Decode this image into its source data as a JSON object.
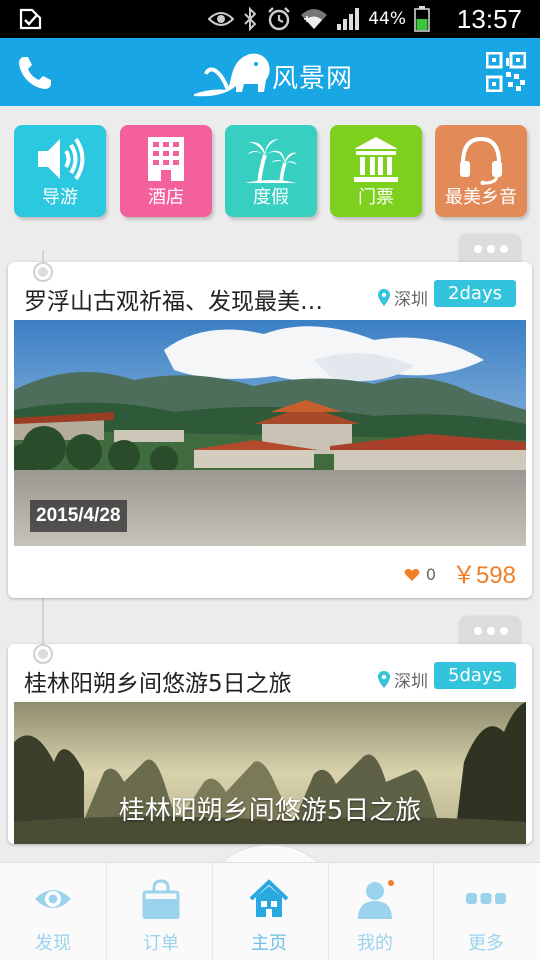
{
  "status_bar": {
    "battery_percent": "44%",
    "time": "13:57",
    "icons": [
      "sim-icon",
      "eye-icon",
      "bluetooth-icon",
      "alarm-icon",
      "wifi-icon",
      "signal-icon",
      "battery-icon"
    ]
  },
  "header": {
    "title": "风景网",
    "left_icon": "phone-icon",
    "right_icon": "qr-code-icon"
  },
  "categories": [
    {
      "label": "导游",
      "icon": "speaker-icon",
      "color": "#2cc8e0"
    },
    {
      "label": "酒店",
      "icon": "hotel-building-icon",
      "color": "#f4609b"
    },
    {
      "label": "度假",
      "icon": "palm-tree-icon",
      "color": "#36cfc0"
    },
    {
      "label": "门票",
      "icon": "museum-icon",
      "color": "#7ed01e"
    },
    {
      "label": "最美乡音",
      "icon": "headphones-icon",
      "color": "#e28a58"
    }
  ],
  "cards": [
    {
      "title": "罗浮山古观祈福、发现最美…",
      "location": "深圳",
      "days": "2days",
      "date": "2015/4/28",
      "likes": "0",
      "price": "￥598"
    },
    {
      "title": "桂林阳朔乡间悠游5日之旅",
      "location": "深圳",
      "days": "5days",
      "image_caption": "桂林阳朔乡间悠游5日之旅"
    }
  ],
  "bottom_nav": [
    {
      "label": "发现",
      "icon": "eye-icon"
    },
    {
      "label": "订单",
      "icon": "shopping-bag-icon"
    },
    {
      "label": "主页",
      "icon": "home-icon",
      "active": true
    },
    {
      "label": "我的",
      "icon": "user-icon"
    },
    {
      "label": "更多",
      "icon": "more-dots-icon"
    }
  ],
  "colors": {
    "header": "#18a6e4",
    "accent": "#34c3dc",
    "price": "#f07f28",
    "like": "#f07f28"
  }
}
